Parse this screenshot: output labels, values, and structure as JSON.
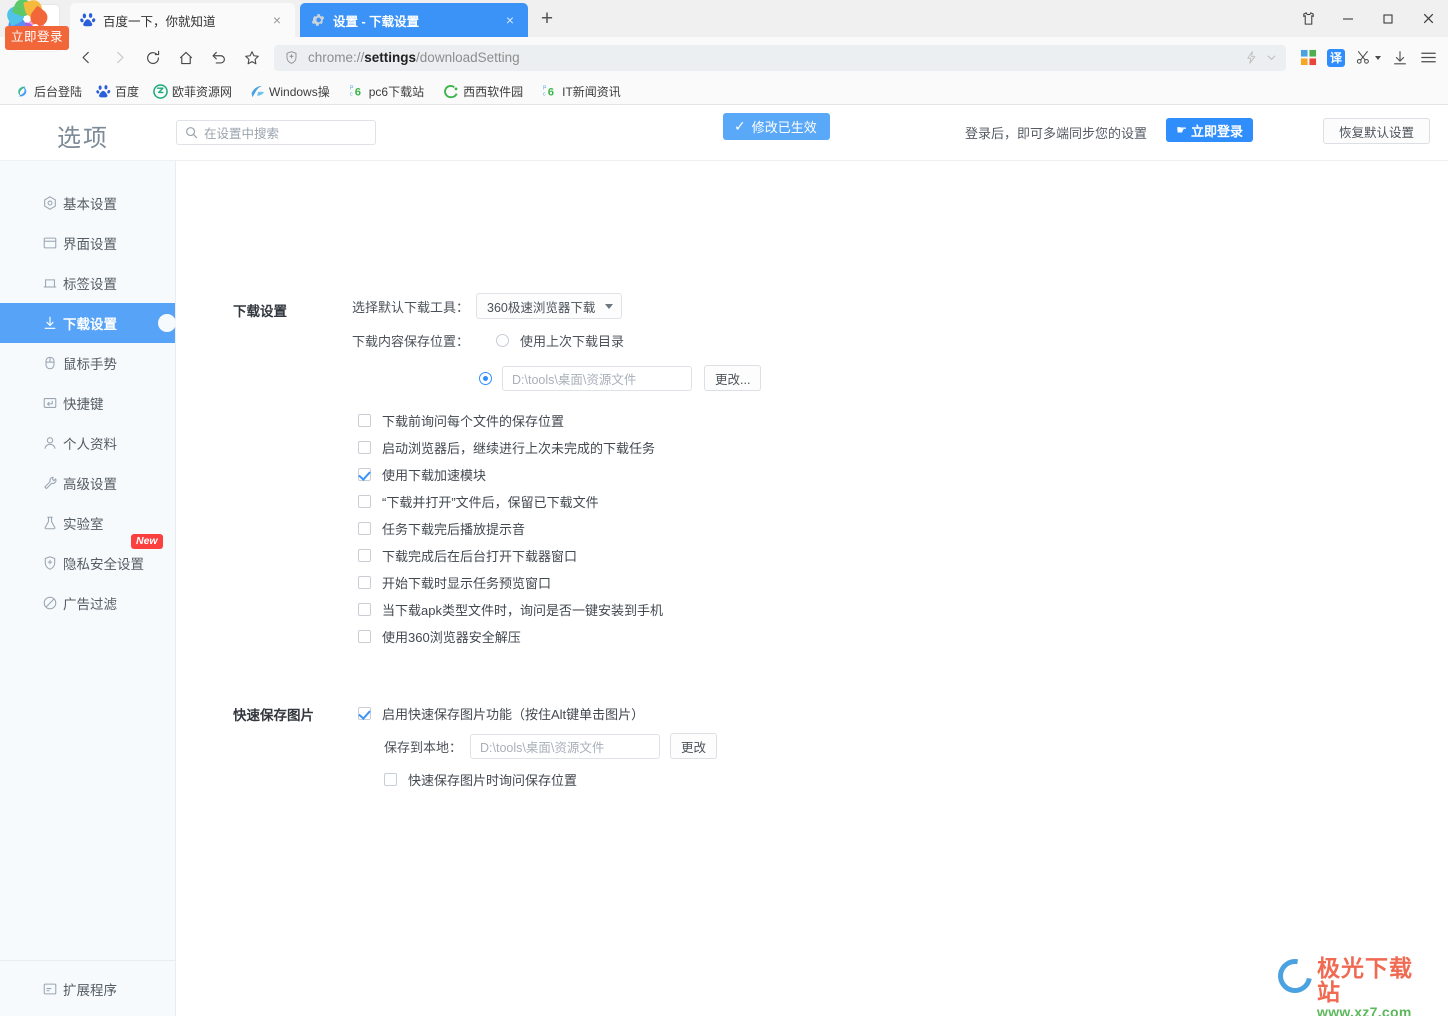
{
  "window": {
    "controls": [
      {
        "name": "skin-icon",
        "glyph": "skin"
      },
      {
        "name": "minimize-button",
        "glyph": "minimize"
      },
      {
        "name": "maximize-button",
        "glyph": "maximize"
      },
      {
        "name": "close-button",
        "glyph": "close"
      }
    ]
  },
  "brand": {
    "login_badge": "立即登录"
  },
  "tabs": [
    {
      "title": "百度一下，你就知道",
      "favicon": "baidu-icon",
      "active": false,
      "close": "×"
    },
    {
      "title": "设置 - 下载设置",
      "favicon": "gear-icon",
      "active": true,
      "close": "×"
    }
  ],
  "newtab_label": "+",
  "nav": {
    "back": "‹",
    "forward": "›",
    "reload": "⟳",
    "home": "⌂",
    "undo": "↺",
    "bookmark": "☆",
    "url_prefix": "chrome://",
    "url_bold": "settings",
    "url_suffix": "/downloadSetting",
    "lightning": "⚡",
    "chevron": "⌄",
    "apps_icon": "apps-icon",
    "translate_label": "译",
    "scissors_icon": "scissors-icon",
    "download_icon": "download-icon",
    "menu_icon": "menu-icon"
  },
  "bookmarks": [
    {
      "label": "后台登陆",
      "icon": "spiral-icon",
      "color": "#4fc3a1"
    },
    {
      "label": "百度",
      "icon": "baidu-icon",
      "color": "#3b7cf5"
    },
    {
      "label": "欧菲资源网",
      "icon": "circle-icon",
      "color": "#1aa97c"
    },
    {
      "label": "Windows操",
      "icon": "windows-icon",
      "color": "#4aa3e0"
    },
    {
      "label": "pc6下载站",
      "icon": "pc6-icon",
      "color": "#3bb54a"
    },
    {
      "label": "西西软件园",
      "icon": "cx-icon",
      "color": "#3bb54a"
    },
    {
      "label": "IT新闻资讯",
      "icon": "pc6-icon",
      "color": "#3bb54a"
    }
  ],
  "header": {
    "options_title": "选项",
    "search_placeholder": "在设置中搜索",
    "search_icon": "search-icon",
    "saved_badge": "修改已生效",
    "saved_check": "✓",
    "sync_text": "登录后，即可多端同步您的设置",
    "login_button": "立即登录",
    "restore_button": "恢复默认设置"
  },
  "sidebar": {
    "items": [
      {
        "label": "基本设置",
        "icon": "target-icon",
        "active": false,
        "badge": null
      },
      {
        "label": "界面设置",
        "icon": "window-icon",
        "active": false,
        "badge": null
      },
      {
        "label": "标签设置",
        "icon": "tab-icon",
        "active": false,
        "badge": null
      },
      {
        "label": "下载设置",
        "icon": "download-icon",
        "active": true,
        "badge": null
      },
      {
        "label": "鼠标手势",
        "icon": "mouse-icon",
        "active": false,
        "badge": null
      },
      {
        "label": "快捷键",
        "icon": "keyboard-icon",
        "active": false,
        "badge": null
      },
      {
        "label": "个人资料",
        "icon": "user-icon",
        "active": false,
        "badge": null
      },
      {
        "label": "高级设置",
        "icon": "wrench-icon",
        "active": false,
        "badge": null
      },
      {
        "label": "实验室",
        "icon": "flask-icon",
        "active": false,
        "badge": null
      },
      {
        "label": "隐私安全设置",
        "icon": "shield-icon",
        "active": false,
        "badge": "New"
      },
      {
        "label": "广告过滤",
        "icon": "block-icon",
        "active": false,
        "badge": null
      }
    ],
    "bottom": {
      "label": "扩展程序",
      "icon": "extension-icon"
    }
  },
  "main": {
    "download_section": {
      "title": "下载设置",
      "tool_label": "选择默认下载工具：",
      "tool_value": "360极速浏览器下载",
      "location_label": "下载内容保存位置：",
      "radio_last_dir": {
        "label": "使用上次下载目录",
        "checked": false
      },
      "radio_custom": {
        "checked": true
      },
      "path_value": "D:\\tools\\桌面\\资源文件",
      "change_button": "更改...",
      "checkboxes": [
        {
          "label": "下载前询问每个文件的保存位置",
          "checked": false
        },
        {
          "label": "启动浏览器后，继续进行上次未完成的下载任务",
          "checked": false
        },
        {
          "label": "使用下载加速模块",
          "checked": true
        },
        {
          "label": "“下载并打开”文件后，保留已下载文件",
          "checked": false
        },
        {
          "label": "任务下载完后播放提示音",
          "checked": false
        },
        {
          "label": "下载完成后在后台打开下载器窗口",
          "checked": false
        },
        {
          "label": "开始下载时显示任务预览窗口",
          "checked": false
        },
        {
          "label": "当下载apk类型文件时，询问是否一键安装到手机",
          "checked": false
        },
        {
          "label": "使用360浏览器安全解压",
          "checked": false
        }
      ]
    },
    "quicksave_section": {
      "title": "快速保存图片",
      "enable": {
        "label": "启用快速保存图片功能（按住Alt键单击图片）",
        "checked": true
      },
      "save_to_label": "保存到本地：",
      "path_value": "D:\\tools\\桌面\\资源文件",
      "change_button": "更改",
      "ask_location": {
        "label": "快速保存图片时询问保存位置",
        "checked": false
      }
    }
  },
  "watermark": {
    "line1": "极光下载站",
    "line2": "www.xz7.com"
  },
  "colors": {
    "accent": "#3b93f7",
    "active_tab": "#3b93f7",
    "sidebar_active": "#56a3f8",
    "badge_red": "#fc3f3f",
    "login_orange": "#f2673a"
  }
}
